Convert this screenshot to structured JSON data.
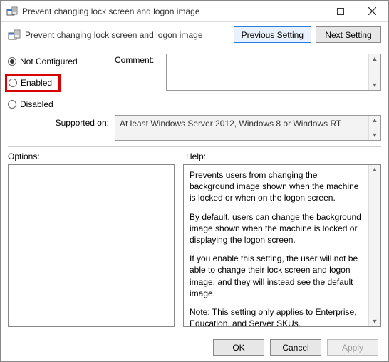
{
  "window": {
    "title": "Prevent changing lock screen and logon image"
  },
  "header": {
    "policy_title": "Prevent changing lock screen and logon image",
    "prev_btn": "Previous Setting",
    "next_btn": "Next Setting"
  },
  "state": {
    "not_configured": "Not Configured",
    "enabled": "Enabled",
    "disabled": "Disabled",
    "selected": "not_configured",
    "comment_label": "Comment:",
    "comment_value": ""
  },
  "supported": {
    "label": "Supported on:",
    "text": "At least Windows Server 2012, Windows 8 or Windows RT"
  },
  "labels": {
    "options": "Options:",
    "help": "Help:"
  },
  "help": {
    "p1": "Prevents users from changing the background image shown when the machine is locked or when on the logon screen.",
    "p2": "By default, users can change the background image shown when the machine is locked or displaying the logon screen.",
    "p3": "If you enable this setting, the user will not be able to change their lock screen and logon image, and they will instead see the default image.",
    "p4": "Note: This setting only applies to Enterprise, Education, and Server SKUs."
  },
  "footer": {
    "ok": "OK",
    "cancel": "Cancel",
    "apply": "Apply"
  }
}
